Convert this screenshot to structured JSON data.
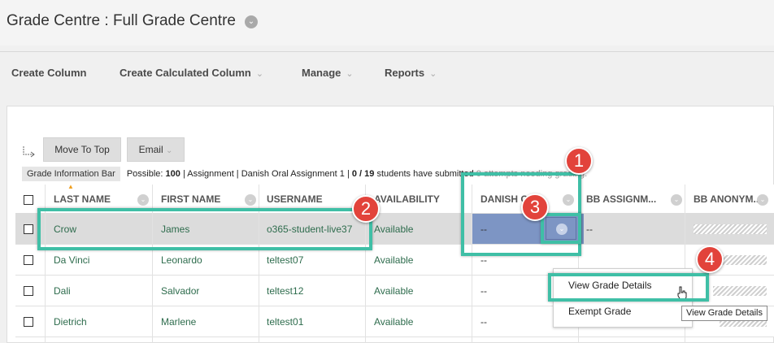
{
  "title": {
    "text": "Grade Centre : Full Grade Centre",
    "icon": "chevron-down-icon"
  },
  "action_bar": [
    {
      "label": "Create Column",
      "dropdown": false
    },
    {
      "label": "Create Calculated Column",
      "dropdown": true
    },
    {
      "label": "Manage",
      "dropdown": true
    },
    {
      "label": "Reports",
      "dropdown": true
    }
  ],
  "toolbar": {
    "move_to_top": "Move To Top",
    "email": "Email"
  },
  "info_bar": {
    "label": "Grade Information Bar",
    "possible_prefix": "Possible:",
    "possible_value": "100",
    "rest": "| Assignment | Danish Oral Assignment 1 |",
    "submitted_value": "0 / 19",
    "submitted_text": "students have submitted",
    "obscured": "0 attempts needing grading."
  },
  "columns": [
    "LAST NAME",
    "FIRST NAME",
    "USERNAME",
    "AVAILABILITY",
    "DANISH O",
    "BB ASSIGNM...",
    "BB ANONYM..."
  ],
  "rows": [
    {
      "last": "Crow",
      "first": "James",
      "username": "o365-student-live37",
      "availability": "Available",
      "danish": "--",
      "bb_assign": "--"
    },
    {
      "last": "Da Vinci",
      "first": "Leonardo",
      "username": "teltest07",
      "availability": "Available",
      "danish": "--",
      "bb_assign": ""
    },
    {
      "last": "Dali",
      "first": "Salvador",
      "username": "teltest12",
      "availability": "Available",
      "danish": "--",
      "bb_assign": ""
    },
    {
      "last": "Dietrich",
      "first": "Marlene",
      "username": "teltest01",
      "availability": "Available",
      "danish": "--",
      "bb_assign": ""
    }
  ],
  "context_menu": [
    "View Grade Details",
    "Exempt Grade"
  ],
  "tooltip": "View Grade Details",
  "callouts": [
    "1",
    "2",
    "3",
    "4"
  ],
  "colors": {
    "highlight": "#3fbfa6",
    "badge": "#e2433b",
    "selected_cell": "#7d95c4",
    "link_green": "#2e6c4d"
  }
}
